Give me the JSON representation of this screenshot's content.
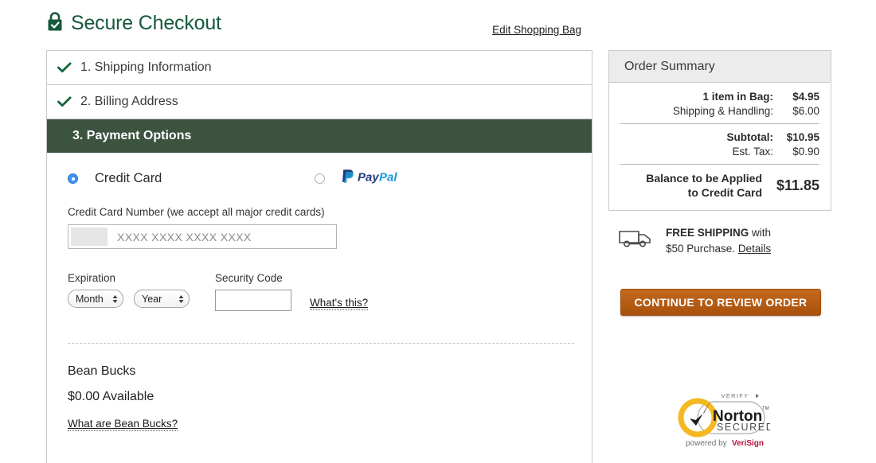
{
  "header": {
    "title": "Secure Checkout",
    "lock_icon": "lock-check-icon",
    "edit_bag_label": "Edit Shopping Bag",
    "title_color": "#17593c"
  },
  "steps": [
    {
      "label": "1. Shipping Information",
      "state": "complete",
      "icon": "check-icon"
    },
    {
      "label": "2. Billing Address",
      "state": "complete",
      "icon": "check-icon"
    },
    {
      "label": "3. Payment Options",
      "state": "active",
      "icon": ""
    }
  ],
  "payment": {
    "methods": [
      {
        "label": "Credit Card",
        "selected": true
      },
      {
        "label": "PayPal",
        "selected": false,
        "logo": "paypal-logo"
      }
    ],
    "card_number": {
      "label": "Credit Card Number (we accept all major credit cards)",
      "placeholder": "XXXX XXXX XXXX XXXX",
      "value": ""
    },
    "expiration": {
      "label": "Expiration",
      "month_value": "Month",
      "year_value": "Year"
    },
    "security_code": {
      "label": "Security Code",
      "value": "",
      "help_link": "What's this?"
    }
  },
  "bean_bucks": {
    "title": "Bean Bucks",
    "amount": "$0.00 Available",
    "link": "What are Bean Bucks?"
  },
  "order_summary": {
    "heading": "Order Summary",
    "rows": [
      {
        "label": "1 item in Bag:",
        "value": "$4.95",
        "bold": true
      },
      {
        "label": "Shipping & Handling:",
        "value": "$6.00",
        "bold": false
      },
      {
        "label": "Subtotal:",
        "value": "$10.95",
        "bold": true
      },
      {
        "label": "Est. Tax:",
        "value": "$0.90",
        "bold": false
      }
    ],
    "balance_label_line1": "Balance to be Applied",
    "balance_label_line2": "to Credit Card",
    "balance_value": "$11.85"
  },
  "shipping_promo": {
    "icon": "truck-icon",
    "strong": "FREE SHIPPING",
    "rest_line1": " with",
    "line2": "$50 Purchase. ",
    "details": "Details"
  },
  "cta": {
    "label": "CONTINUE TO REVIEW ORDER",
    "color": "#b45a12"
  },
  "trust_badge": {
    "verify": "VERIFY",
    "brand": "Norton",
    "secured": "SECURED",
    "tm": "TM",
    "powered_by": "powered by ",
    "verisign": "VeriSign"
  }
}
